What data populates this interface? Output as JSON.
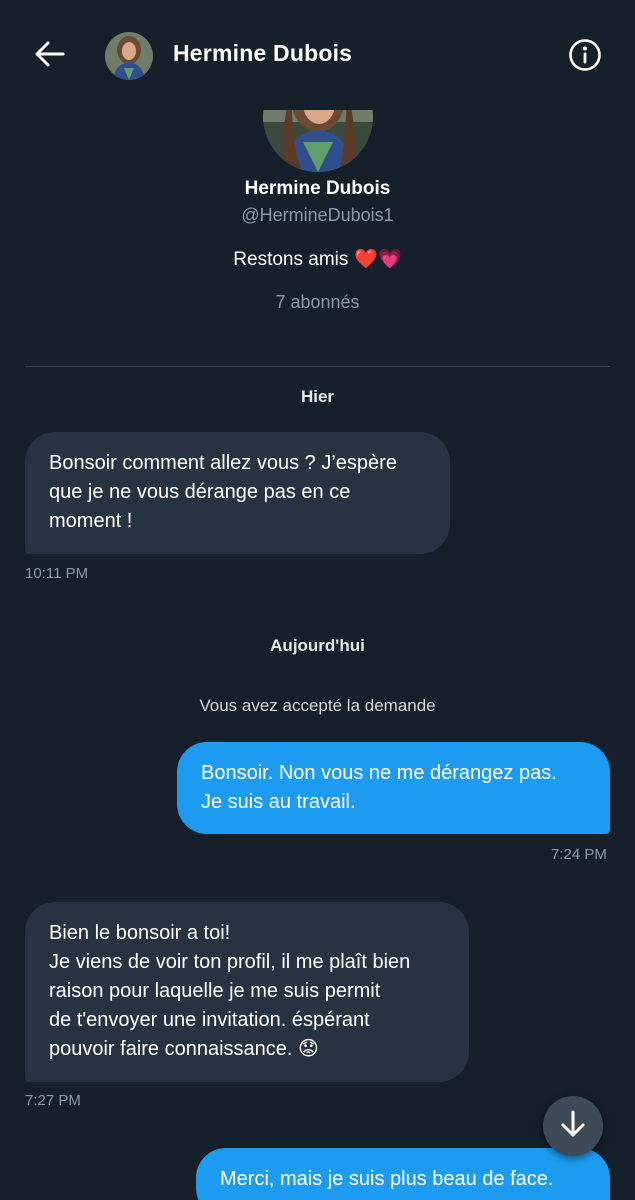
{
  "header": {
    "title": "Hermine Dubois"
  },
  "profile": {
    "name": "Hermine Dubois",
    "handle": "@HermineDubois1",
    "bio": "Restons amis",
    "bio_emoji": "❤️💗",
    "followers": "7 abonnés"
  },
  "conversation": {
    "day1_label": "Hier",
    "msg1": {
      "text": "Bonsoir comment allez vous ? J’espère\nque je ne vous dérange pas en ce\nmoment !",
      "time": "10:11 PM"
    },
    "day2_label": "Aujourd'hui",
    "system_note": "Vous avez accepté la demande",
    "msg2": {
      "text": "Bonsoir. Non vous ne me dérangez pas.\nJe suis au travail.",
      "time": "7:24 PM"
    },
    "msg3": {
      "text": "Bien le bonsoir a toi!\nJe viens de voir ton profil, il me plaît bien\nraison pour laquelle je me suis  permit\nde t'envoyer une invitation. éspérant\npouvoir faire connaissance. 😟",
      "time": "7:27 PM"
    },
    "msg4": {
      "text": "Merci, mais je suis plus beau de face."
    }
  },
  "icons": {
    "back": "arrow-left-icon",
    "info": "info-icon",
    "scroll_down": "arrow-down-icon"
  },
  "colors": {
    "background": "#15202b",
    "incoming_bubble": "#273340",
    "outgoing_bubble": "#1d9bf0",
    "muted_text": "#8b98a5"
  }
}
